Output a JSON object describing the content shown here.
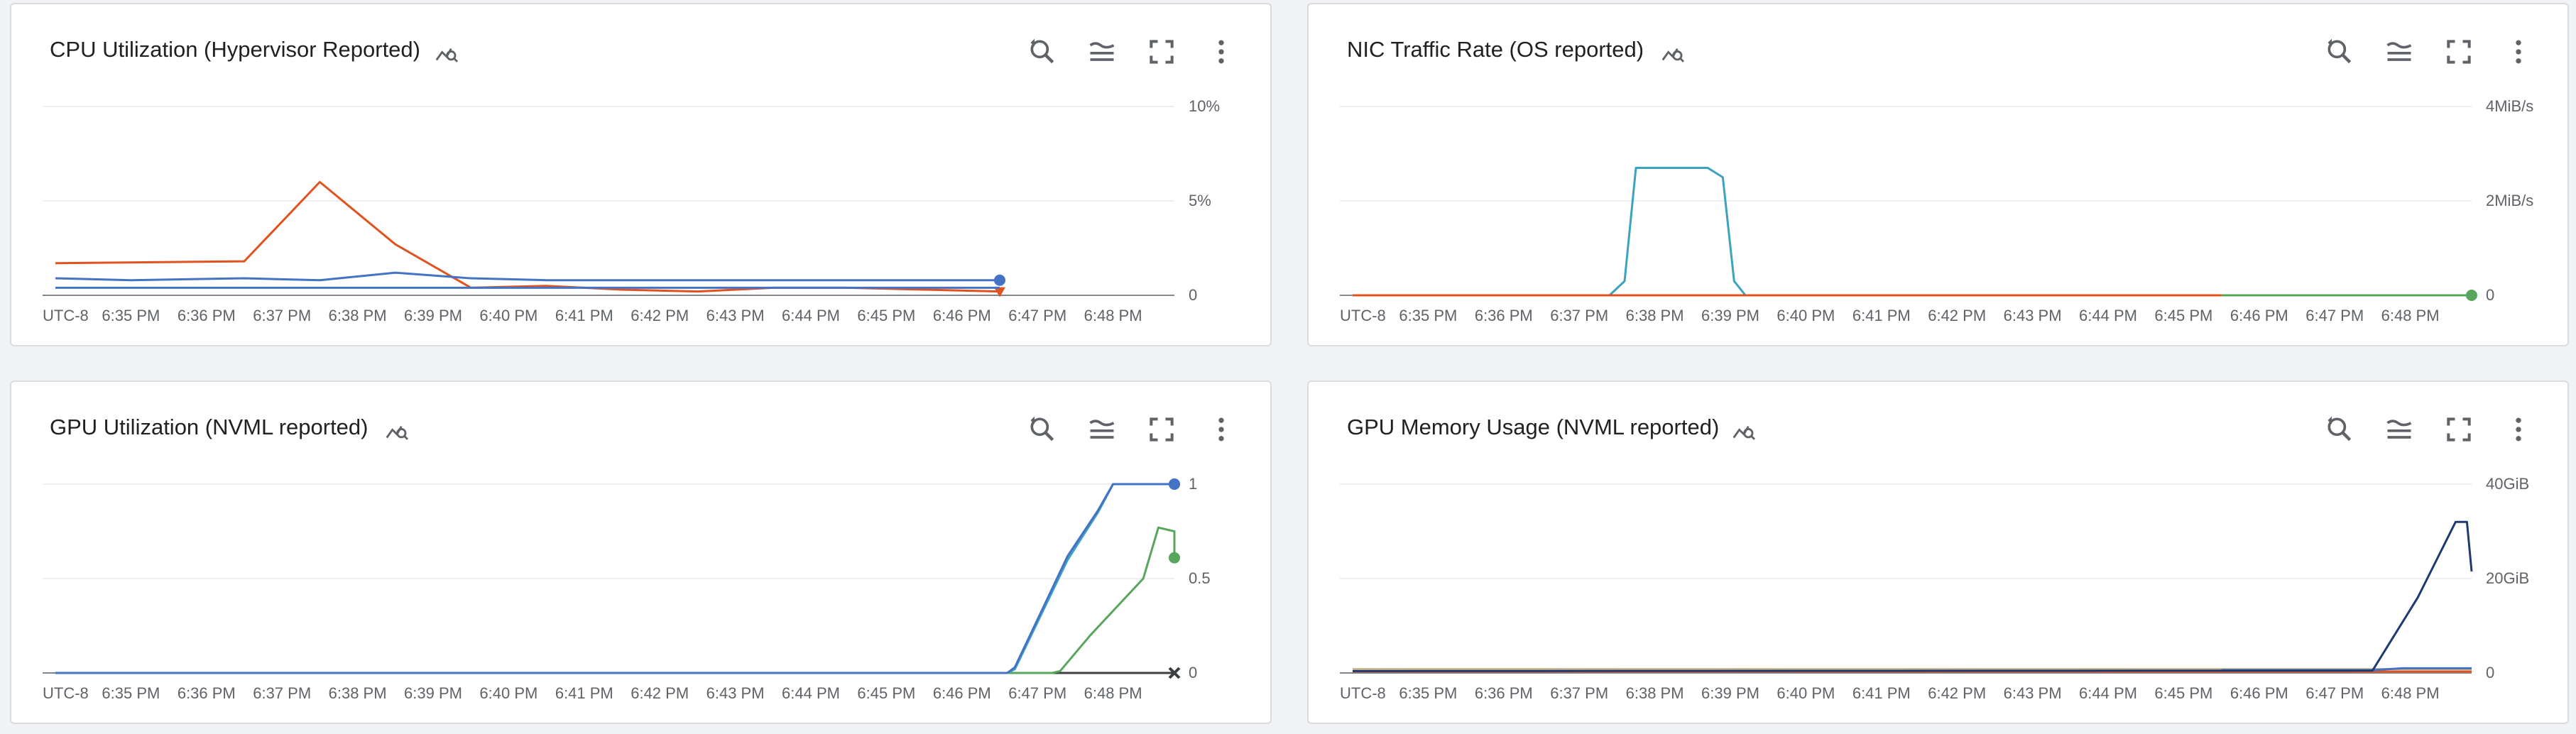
{
  "colors": {
    "grid": "#e8eaed",
    "axis": "#80868b",
    "blue": "#4472c4",
    "orange": "#e0531f",
    "teal": "#3ba3c0",
    "green": "#58a55c",
    "navy": "#1f3a73",
    "tan": "#c9b68a",
    "darkgray": "#3c4043"
  },
  "icons": {
    "explore": "query-stats-icon",
    "zoom": "zoom-search-icon",
    "legend": "legend-lines-icon",
    "fullscreen": "fullscreen-icon",
    "more": "more-vert-icon"
  },
  "chart_data": [
    {
      "type": "line",
      "title": "CPU Utilization (Hypervisor Reported)",
      "x_ticks": [
        "UTC-8",
        "6:35 PM",
        "6:36 PM",
        "6:37 PM",
        "6:38 PM",
        "6:39 PM",
        "6:40 PM",
        "6:41 PM",
        "6:42 PM",
        "6:43 PM",
        "6:44 PM",
        "6:45 PM",
        "6:46 PM",
        "6:47 PM",
        "6:48 PM"
      ],
      "y_ticks": [
        "10%",
        "5%",
        "0"
      ],
      "ylim": [
        0,
        10
      ],
      "y_unit": "%",
      "grid": true,
      "series": [
        {
          "color": "orange",
          "x": [
            0,
            2.5,
            3.5,
            4.5,
            5.5,
            6.5,
            7.5,
            8.5,
            9.5,
            10.5,
            11.5,
            12.5
          ],
          "y": [
            1.7,
            1.8,
            6.0,
            2.7,
            0.4,
            0.5,
            0.3,
            0.2,
            0.4,
            0.4,
            0.3,
            0.2
          ],
          "end_marker": "triangle"
        },
        {
          "color": "blue",
          "x": [
            0,
            1,
            2.5,
            3.5,
            4.5,
            5.5,
            6.5,
            7.5,
            8.5,
            9.5,
            10.5,
            11.5,
            12.5
          ],
          "y": [
            0.9,
            0.8,
            0.9,
            0.8,
            1.2,
            0.9,
            0.8,
            0.8,
            0.8,
            0.8,
            0.8,
            0.8,
            0.8
          ],
          "end_marker": "circle"
        },
        {
          "color": "blue",
          "x": [
            0,
            4.5,
            5.5,
            8.5,
            12.5
          ],
          "y": [
            0.4,
            0.4,
            0.4,
            0.4,
            0.4
          ]
        }
      ]
    },
    {
      "type": "line",
      "title": "NIC Traffic Rate (OS reported)",
      "x_ticks": [
        "UTC-8",
        "6:35 PM",
        "6:36 PM",
        "6:37 PM",
        "6:38 PM",
        "6:39 PM",
        "6:40 PM",
        "6:41 PM",
        "6:42 PM",
        "6:43 PM",
        "6:44 PM",
        "6:45 PM",
        "6:46 PM",
        "6:47 PM",
        "6:48 PM"
      ],
      "y_ticks": [
        "4MiB/s",
        "2MiB/s",
        "0"
      ],
      "ylim": [
        0,
        4
      ],
      "y_unit": "MiB/s",
      "grid": true,
      "series": [
        {
          "color": "teal",
          "x": [
            0,
            3.4,
            3.6,
            3.75,
            4.7,
            4.9,
            5.05,
            5.2,
            15
          ],
          "y": [
            0,
            0,
            0.3,
            2.7,
            2.7,
            2.5,
            0.3,
            0,
            0
          ]
        },
        {
          "color": "orange",
          "x": [
            0,
            15
          ],
          "y": [
            0,
            0
          ]
        },
        {
          "color": "green",
          "x": [
            11.5,
            15
          ],
          "y": [
            0,
            0
          ],
          "end_marker": "circle"
        }
      ]
    },
    {
      "type": "line",
      "title": "GPU Utilization (NVML reported)",
      "x_ticks": [
        "UTC-8",
        "6:35 PM",
        "6:36 PM",
        "6:37 PM",
        "6:38 PM",
        "6:39 PM",
        "6:40 PM",
        "6:41 PM",
        "6:42 PM",
        "6:43 PM",
        "6:44 PM",
        "6:45 PM",
        "6:46 PM",
        "6:47 PM",
        "6:48 PM"
      ],
      "y_ticks": [
        "1",
        "0.5",
        "0"
      ],
      "ylim": [
        0,
        1
      ],
      "grid": true,
      "series": [
        {
          "color": "darkgray",
          "x": [
            0,
            15
          ],
          "y": [
            0,
            0
          ],
          "end_marker": "x"
        },
        {
          "color": "green",
          "x": [
            0,
            13.2,
            13.3,
            13.7,
            14.4,
            14.6,
            14.9,
            15
          ],
          "y": [
            0,
            0,
            0.01,
            0.2,
            0.5,
            0.77,
            0.75,
            0.61
          ],
          "end_marker": "circle"
        },
        {
          "color": "teal",
          "x": [
            0,
            12.6,
            12.7,
            13.4,
            13.8,
            14,
            15
          ],
          "y": [
            0,
            0,
            0.02,
            0.6,
            0.85,
            1,
            1
          ],
          "end_marker": "circle"
        },
        {
          "color": "blue",
          "x": [
            0,
            12.6,
            12.7,
            13.4,
            13.8,
            14,
            15
          ],
          "y": [
            0,
            0,
            0.03,
            0.62,
            0.86,
            1,
            1
          ],
          "end_marker": "circle"
        }
      ]
    },
    {
      "type": "line",
      "title": "GPU Memory Usage (NVML reported)",
      "x_ticks": [
        "UTC-8",
        "6:35 PM",
        "6:36 PM",
        "6:37 PM",
        "6:38 PM",
        "6:39 PM",
        "6:40 PM",
        "6:41 PM",
        "6:42 PM",
        "6:43 PM",
        "6:44 PM",
        "6:45 PM",
        "6:46 PM",
        "6:47 PM",
        "6:48 PM"
      ],
      "y_ticks": [
        "40GiB",
        "20GiB",
        "0"
      ],
      "ylim": [
        0,
        40
      ],
      "y_unit": "GiB",
      "grid": true,
      "series": [
        {
          "color": "tan",
          "x": [
            0,
            15
          ],
          "y": [
            0.8,
            0.8
          ]
        },
        {
          "color": "orange",
          "x": [
            0,
            15
          ],
          "y": [
            0.3,
            0.3
          ]
        },
        {
          "color": "blue",
          "x": [
            11.5,
            13.5,
            13.9,
            15
          ],
          "y": [
            0.6,
            0.6,
            1,
            1
          ]
        },
        {
          "color": "navy",
          "x": [
            0,
            13.5,
            14.1,
            14.6,
            14.75,
            15.2
          ],
          "y": [
            0.4,
            0.5,
            16,
            32,
            32,
            21.5
          ]
        }
      ]
    }
  ]
}
